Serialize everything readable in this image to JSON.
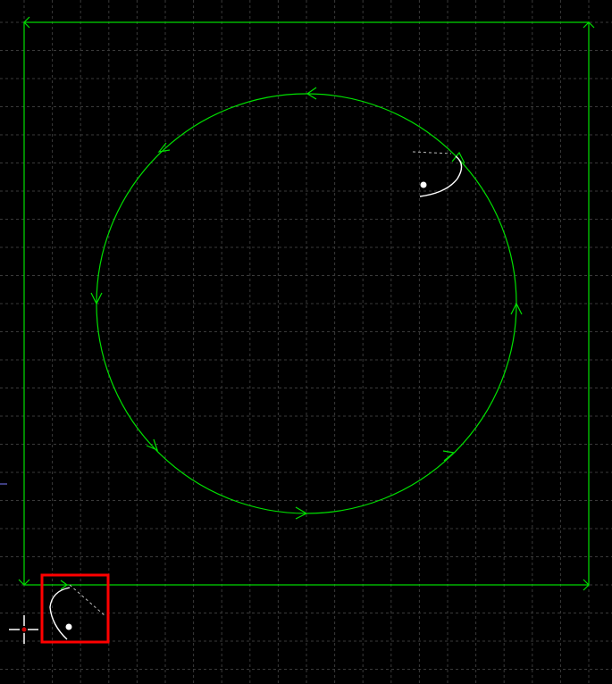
{
  "canvas": {
    "background": "#000000",
    "grid_color": "#3a3a3a",
    "grid_style": "dashed",
    "path_color": "#00e000",
    "lead_color": "#ffffff"
  },
  "toolpaths": [
    {
      "name": "outer-rectangle-contour",
      "shape": "rectangle",
      "direction": "clockwise"
    },
    {
      "name": "inner-circle-contour",
      "shape": "circle",
      "direction": "counterclockwise"
    }
  ],
  "lead_markers": [
    {
      "name": "circle-lead-in",
      "marker": "start-point"
    },
    {
      "name": "rectangle-lead-in",
      "marker": "start-point",
      "highlight_color": "#ff0000"
    }
  ],
  "cursor": {
    "icon": "crosshair-cursor-icon",
    "color": "#ffffff",
    "center_color": "#d00000"
  }
}
